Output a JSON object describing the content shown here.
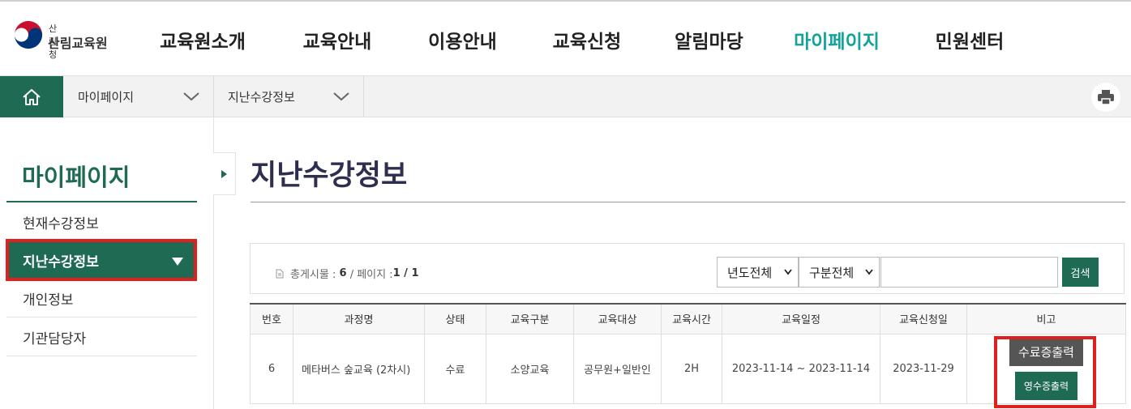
{
  "logo": {
    "small": "산림청",
    "big": "산림교육원"
  },
  "gnb": [
    {
      "label": "교육원소개"
    },
    {
      "label": "교육안내"
    },
    {
      "label": "이용안내"
    },
    {
      "label": "교육신청"
    },
    {
      "label": "알림마당"
    },
    {
      "label": "마이페이지",
      "active": true
    },
    {
      "label": "민원센터"
    }
  ],
  "breadcrumb": [
    {
      "label": "마이페이지"
    },
    {
      "label": "지난수강정보"
    }
  ],
  "sidebar": {
    "title": "마이페이지",
    "items": [
      {
        "label": "현재수강정보"
      },
      {
        "label": "지난수강정보",
        "active": true
      },
      {
        "label": "개인정보"
      },
      {
        "label": "기관담당자"
      }
    ]
  },
  "page_title": "지난수강정보",
  "search": {
    "count_label": "총게시물 :",
    "count_value": "6",
    "page_label": "/ 페이지 :",
    "page_value": "1 / 1",
    "year_select": "년도전체",
    "type_select": "구분전체",
    "keyword": "",
    "button": "검색"
  },
  "table": {
    "headers": [
      "번호",
      "과정명",
      "상태",
      "교육구분",
      "교육대상",
      "교육시간",
      "교육일정",
      "교육신청일",
      "비고"
    ],
    "rows": [
      {
        "no": "6",
        "course": "메타버스 숲교육 (2차시)",
        "status": "수료",
        "category": "소양교육",
        "target": "공무원+일반인",
        "hours": "2H",
        "schedule": "2023-11-14 ~ 2023-11-14",
        "applied": "2023-11-29",
        "btn_cert": "수료증출력",
        "btn_receipt": "영수증출력"
      }
    ]
  },
  "colors": {
    "primary": "#1e6a52",
    "accent": "#12a39a",
    "highlight": "#e0201c"
  },
  "icons": [
    "home-icon",
    "chevron-down-icon",
    "print-icon",
    "document-icon",
    "caret-down-icon",
    "caret-right-icon"
  ]
}
